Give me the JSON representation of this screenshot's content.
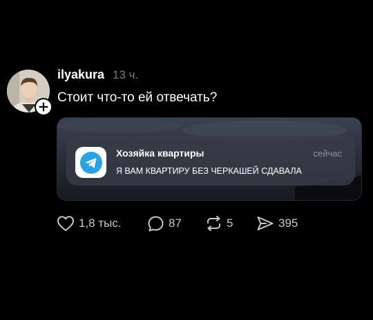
{
  "post": {
    "author": {
      "username": "ilyakura",
      "time": "13 ч."
    },
    "text": "Стоит что-то ей отвечать?",
    "notification": {
      "app_icon": "telegram-icon",
      "sender": "Хозяйка квартиры",
      "time": "сейчас",
      "message": "Я ВАМ КВАРТИРУ БЕЗ ЧЕРКАШЕЙ СДАВАЛА"
    },
    "actions": {
      "likes": "1,8 тыс.",
      "comments": "87",
      "reposts": "5",
      "shares": "395"
    }
  },
  "colors": {
    "background": "#000000",
    "text": "#ffffff",
    "muted": "#7a7a7a",
    "telegram_blue": "#2aa3e3"
  }
}
